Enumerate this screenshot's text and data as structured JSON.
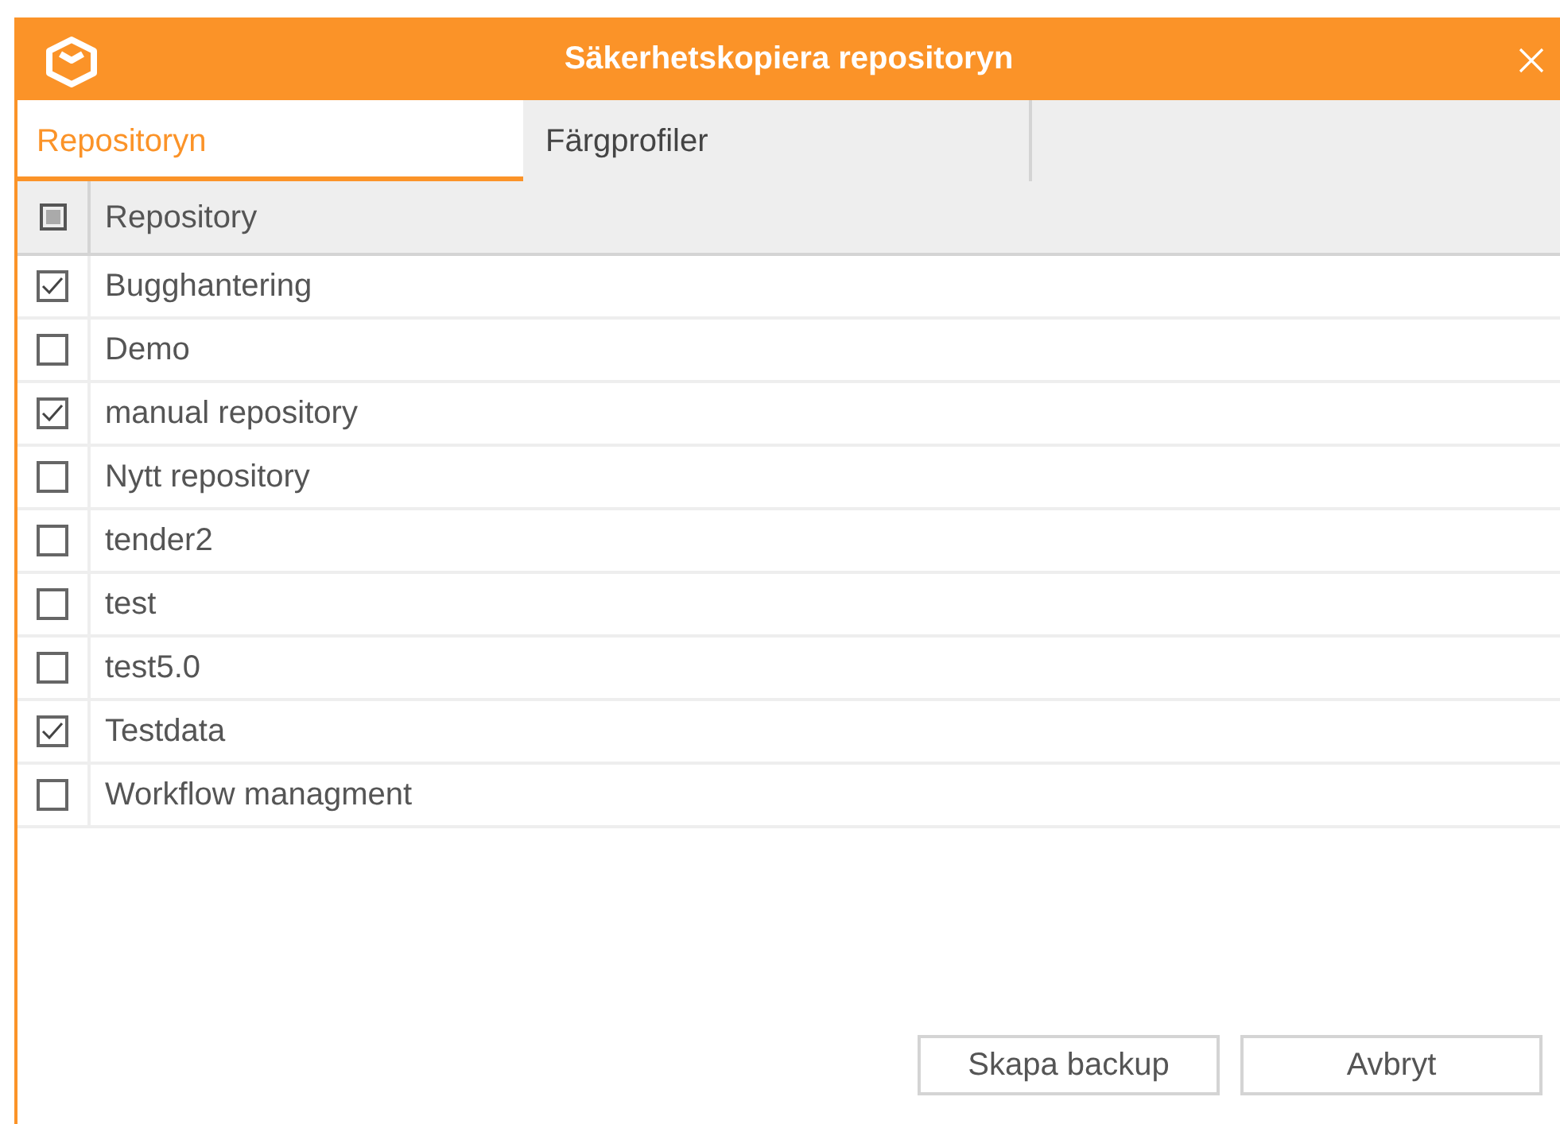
{
  "window": {
    "title": "Säkerhetskopiera repositoryn"
  },
  "tabs": [
    {
      "label": "Repositoryn",
      "selected": true
    },
    {
      "label": "Färgprofiler",
      "selected": false
    }
  ],
  "table": {
    "header": {
      "label": "Repository",
      "indeterminate": true
    },
    "rows": [
      {
        "name": "Bugghantering",
        "checked": true
      },
      {
        "name": "Demo",
        "checked": false
      },
      {
        "name": "manual repository",
        "checked": true
      },
      {
        "name": "Nytt repository",
        "checked": false
      },
      {
        "name": "tender2",
        "checked": false
      },
      {
        "name": "test",
        "checked": false
      },
      {
        "name": "test5.0",
        "checked": false
      },
      {
        "name": "Testdata",
        "checked": true
      },
      {
        "name": "Workflow managment",
        "checked": false
      }
    ]
  },
  "buttons": [
    "Skapa backup",
    "Avbryt"
  ]
}
